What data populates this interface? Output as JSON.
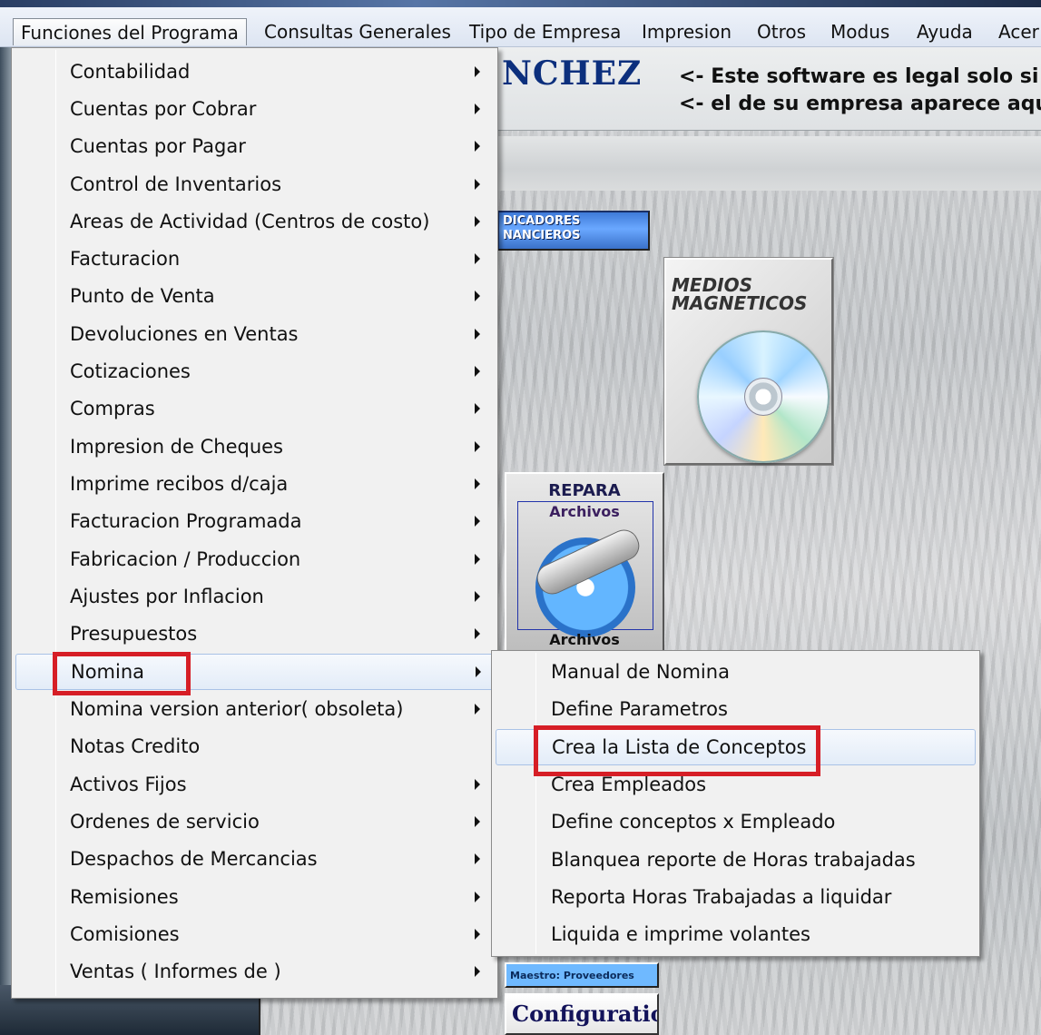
{
  "colors": {
    "annotation_red": "#d61e26",
    "menu_background": "#f1f1f1",
    "hover_highlight": "#e3ecf8",
    "company_name_blue": "#0c2f7d"
  },
  "menubar": {
    "items": [
      "Funciones del Programa",
      "Consultas Generales",
      "Tipo de Empresa",
      "Impresion",
      "Otros",
      "Modus",
      "Ayuda",
      "Acer"
    ],
    "active": "Funciones del Programa"
  },
  "background": {
    "company_name": "NCHEZ",
    "legal_line_1": "<- Este software es legal solo si",
    "legal_line_2": "<- el de su empresa aparece aqu",
    "tile_indicadores_line1": "DICADORES",
    "tile_indicadores_line2": "NANCIEROS",
    "tile_medios_title": "MEDIOS MAGNETICOS",
    "tile_medios_icon": "cd-disc-icon",
    "tile_repara_title": "REPARA",
    "tile_repara_sub": "Archivos",
    "tile_repara_bottom": "Archivos",
    "tile_repara_icon": "wrench-disc-icon",
    "tile_maestro": "Maestro: Proveedores",
    "tile_config": "Configuration de"
  },
  "main_menu": {
    "items": [
      {
        "label": "Contabilidad",
        "has_submenu": true
      },
      {
        "label": "Cuentas por Cobrar",
        "has_submenu": true
      },
      {
        "label": "Cuentas por Pagar",
        "has_submenu": true
      },
      {
        "label": "Control de Inventarios",
        "has_submenu": true
      },
      {
        "label": "Areas de Actividad (Centros de costo)",
        "has_submenu": true
      },
      {
        "label": "Facturacion",
        "has_submenu": true
      },
      {
        "label": "Punto de Venta",
        "has_submenu": true
      },
      {
        "label": "Devoluciones en Ventas",
        "has_submenu": true
      },
      {
        "label": "Cotizaciones",
        "has_submenu": true
      },
      {
        "label": "Compras",
        "has_submenu": true
      },
      {
        "label": "Impresion de Cheques",
        "has_submenu": true
      },
      {
        "label": "Imprime recibos d/caja",
        "has_submenu": true
      },
      {
        "label": "Facturacion Programada",
        "has_submenu": true
      },
      {
        "label": "Fabricacion / Produccion",
        "has_submenu": true
      },
      {
        "label": "Ajustes por Inflacion",
        "has_submenu": true
      },
      {
        "label": "Presupuestos",
        "has_submenu": true
      },
      {
        "label": "Nomina",
        "has_submenu": true,
        "highlighted": true
      },
      {
        "label": "Nomina version anterior( obsoleta)",
        "has_submenu": true
      },
      {
        "label": "Notas Credito",
        "has_submenu": false
      },
      {
        "label": "Activos Fijos",
        "has_submenu": true
      },
      {
        "label": "Ordenes de servicio",
        "has_submenu": true
      },
      {
        "label": "Despachos de Mercancias",
        "has_submenu": true
      },
      {
        "label": "Remisiones",
        "has_submenu": true
      },
      {
        "label": "Comisiones",
        "has_submenu": true
      },
      {
        "label": "Ventas ( Informes de )",
        "has_submenu": true
      }
    ]
  },
  "nomina_submenu": {
    "items": [
      {
        "label": "Manual de Nomina"
      },
      {
        "label": "Define Parametros"
      },
      {
        "label": "Crea la Lista de Conceptos",
        "highlighted": true
      },
      {
        "label": "Crea Empleados"
      },
      {
        "label": "Define conceptos x Empleado"
      },
      {
        "label": "Blanquea reporte de Horas trabajadas"
      },
      {
        "label": "Reporta Horas Trabajadas a liquidar"
      },
      {
        "label": "Liquida e imprime volantes"
      }
    ]
  }
}
